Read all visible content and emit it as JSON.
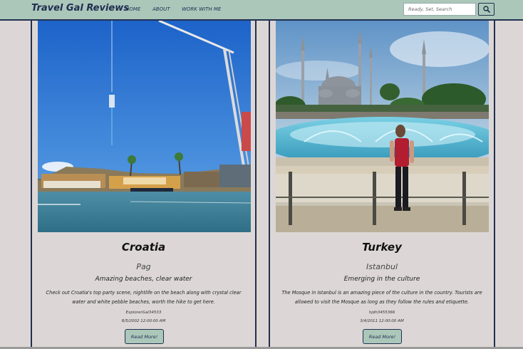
{
  "navbar": {
    "brand": "Travel Gal Reviews",
    "links": [
      "HOME",
      "ABOUT",
      "WORK WITH ME"
    ],
    "search_placeholder": "Ready, Set, Search",
    "search_icon": "magnifier-icon"
  },
  "colors": {
    "navbar_bg": "#abc7ba",
    "accent_dark": "#1f2d4f",
    "page_bg": "#dcd7d6"
  },
  "cards": [
    {
      "title": "Croatia",
      "city": "Pag",
      "tagline": "Amazing beaches, clear water",
      "description": "Check out Croatia's top party scene, nightlife on the beach along with crystal clear water and white pebble beaches, worth the hike to get here.",
      "user": "ExplorerGal34533",
      "date": "8/5/2002 12:00:00 AM",
      "button": "Read More!"
    },
    {
      "title": "Turkey",
      "city": "Istanbul",
      "tagline": "Emerging in the culture",
      "description": "The Mosque in Istanbul is an amazing piece of the culture in the country. Tourists are allowed to visit the Mosque as long as they follow the rules and etiquette.",
      "user": "hjdh3455366",
      "date": "3/4/2011 12:00:00 AM",
      "button": "Read More!"
    }
  ]
}
